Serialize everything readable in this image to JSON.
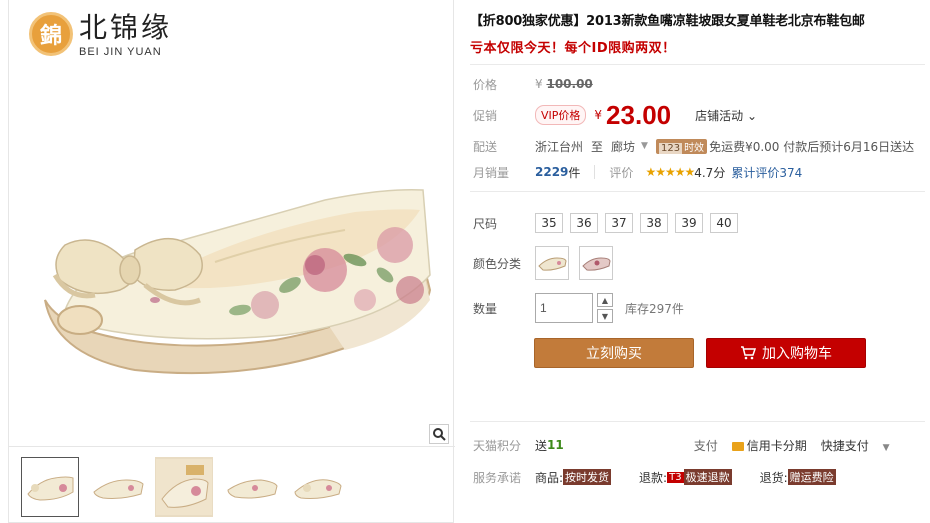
{
  "brand": {
    "cn": "北锦缘",
    "en": "BEI JIN YUAN",
    "seal": "錦"
  },
  "product": {
    "title": "【折800独家优惠】2013新款鱼嘴凉鞋坡跟女夏单鞋老北京布鞋包邮",
    "subtitle": "亏本仅限今天！每个ID限购两双！"
  },
  "price": {
    "label": "价格",
    "currency": "¥",
    "original": "100.00"
  },
  "promo": {
    "label": "促销",
    "vip": "VIP价格",
    "currency": "¥",
    "price": "23.00",
    "store_activity": "店铺活动"
  },
  "shipping": {
    "label": "配送",
    "from": "浙江台州",
    "to_word": "至",
    "to": "廊坊",
    "tag_num": "123",
    "tag_text": "时效",
    "free": "免运费¥0.00 付款后预计6月16日送达"
  },
  "sales": {
    "label": "月销量",
    "count": "2229",
    "unit": "件",
    "rating_label": "评价",
    "stars": "★★★★★",
    "score": "4.7分",
    "review_text": "累计评价374"
  },
  "sku": {
    "size_label": "尺码",
    "sizes": [
      "35",
      "36",
      "37",
      "38",
      "39",
      "40"
    ],
    "color_label": "颜色分类",
    "qty_label": "数量",
    "qty_value": "1",
    "stock": "库存297件"
  },
  "actions": {
    "buy": "立刻购买",
    "cart": "加入购物车"
  },
  "bottom": {
    "points_label": "天猫积分",
    "points_prefix": "送",
    "points_value": "11",
    "pay_label": "支付",
    "credit": "信用卡分期",
    "quick_pay": "快捷支付",
    "service_label": "服务承诺",
    "goods_prefix": "商品:",
    "goods_tag": "按时发货",
    "refund_prefix": "退款:",
    "refund_t3": "T3",
    "refund_tag": "极速退款",
    "return_prefix": "退货:",
    "return_tag": "赠运费险"
  },
  "colors": {
    "accent_red": "#c40000",
    "buy_brown": "#c27b3a",
    "link_blue": "#2b5f9e"
  }
}
